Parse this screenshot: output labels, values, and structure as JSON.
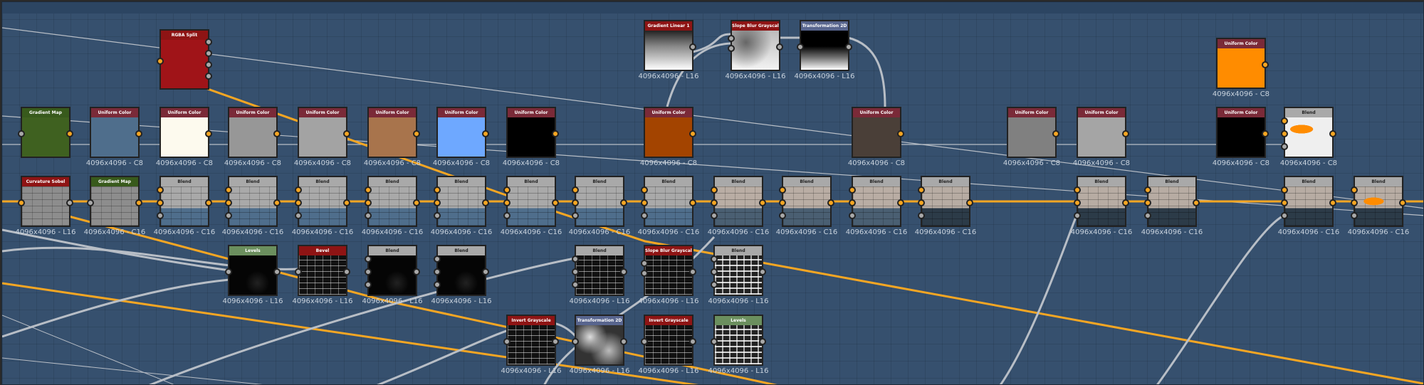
{
  "colors": {
    "uniform_header": "#7a2a38",
    "atomic_header": "#8e1414",
    "blend_header": "#a9a9a9",
    "gradient_map_header": "#385a1c",
    "levels_header": "#6b8f5e",
    "transform_header": "#58658e",
    "color_wire": "#f5a623",
    "gray_wire": "#b8bec6"
  },
  "nodes": [
    {
      "title": "RGBA Split",
      "kind": "atomic",
      "preview": "#a01418",
      "label": ""
    },
    {
      "title": "Gradient Linear 1",
      "kind": "atomic",
      "preview": "gradlin",
      "label": "4096x4096 - L16"
    },
    {
      "title": "Slope Blur Grayscale",
      "kind": "atomic",
      "preview": "slope",
      "label": "4096x4096 - L16"
    },
    {
      "title": "Transformation 2D",
      "kind": "transform",
      "preview": "gradblack",
      "label": "4096x4096 - L16"
    },
    {
      "title": "Uniform Color",
      "kind": "uniform",
      "preview": "#ff8c00",
      "label": "4096x4096 - C8"
    },
    {
      "title": "Gradient Map",
      "kind": "gradmap",
      "preview": "#3f6120",
      "label": ""
    },
    {
      "title": "Uniform Color",
      "kind": "uniform",
      "preview": "#4f6e8c",
      "label": "4096x4096 - C8"
    },
    {
      "title": "Uniform Color",
      "kind": "uniform",
      "preview": "#fdfaee",
      "label": "4096x4096 - C8"
    },
    {
      "title": "Uniform Color",
      "kind": "uniform",
      "preview": "#979797",
      "label": "4096x4096 - C8"
    },
    {
      "title": "Uniform Color",
      "kind": "uniform",
      "preview": "#a3a3a3",
      "label": "4096x4096 - C8"
    },
    {
      "title": "Uniform Color",
      "kind": "uniform",
      "preview": "#a8744c",
      "label": "4096x4096 - C8"
    },
    {
      "title": "Uniform Color",
      "kind": "uniform",
      "preview": "#6ea8ff",
      "label": "4096x4096 - C8"
    },
    {
      "title": "Uniform Color",
      "kind": "uniform",
      "preview": "#000000",
      "label": "4096x4096 - C8"
    },
    {
      "title": "Uniform Color",
      "kind": "uniform",
      "preview": "#a34400",
      "label": "4096x4096 - C8"
    },
    {
      "title": "Uniform Color",
      "kind": "uniform",
      "preview": "#4a3f38",
      "label": "4096x4096 - C8"
    },
    {
      "title": "Uniform Color",
      "kind": "uniform",
      "preview": "#808080",
      "label": "4096x4096 - C8"
    },
    {
      "title": "Uniform Color",
      "kind": "uniform",
      "preview": "#a5a5a5",
      "label": "4096x4096 - C8"
    },
    {
      "title": "Uniform Color",
      "kind": "uniform",
      "preview": "#000000",
      "label": "4096x4096 - C8"
    },
    {
      "title": "Blend",
      "kind": "blend",
      "preview": "graffiti",
      "label": "4096x4096 - C8"
    },
    {
      "title": "Curvature Sobel",
      "kind": "atomic",
      "preview": "brickgray",
      "label": "4096x4096 - L16"
    },
    {
      "title": "Gradient Map",
      "kind": "gradmap",
      "preview": "brickgray",
      "label": "4096x4096 - C16"
    },
    {
      "title": "Blend",
      "kind": "blend",
      "preview": "brickblue",
      "label": "4096x4096 - C16"
    },
    {
      "title": "Blend",
      "kind": "blend",
      "preview": "brickblue",
      "label": "4096x4096 - C16"
    },
    {
      "title": "Blend",
      "kind": "blend",
      "preview": "brickblue",
      "label": "4096x4096 - C16"
    },
    {
      "title": "Blend",
      "kind": "blend",
      "preview": "brickblue",
      "label": "4096x4096 - C16"
    },
    {
      "title": "Blend",
      "kind": "blend",
      "preview": "brickblue",
      "label": "4096x4096 - C16"
    },
    {
      "title": "Blend",
      "kind": "blend",
      "preview": "brickblue",
      "label": "4096x4096 - C16"
    },
    {
      "title": "Blend",
      "kind": "blend",
      "preview": "brickblue",
      "label": "4096x4096 - C16"
    },
    {
      "title": "Blend",
      "kind": "blend",
      "preview": "brickblue",
      "label": "4096x4096 - C16"
    },
    {
      "title": "Blend",
      "kind": "blend",
      "preview": "brickbeige",
      "label": "4096x4096 - C16"
    },
    {
      "title": "Blend",
      "kind": "blend",
      "preview": "brickbeige",
      "label": "4096x4096 - C16"
    },
    {
      "title": "Blend",
      "kind": "blend",
      "preview": "brickbeige",
      "label": "4096x4096 - C16"
    },
    {
      "title": "Blend",
      "kind": "blend",
      "preview": "brickdark",
      "label": "4096x4096 - C16"
    },
    {
      "title": "Blend",
      "kind": "blend",
      "preview": "brickdark",
      "label": "4096x4096 - C16"
    },
    {
      "title": "Blend",
      "kind": "blend",
      "preview": "brickdark",
      "label": "4096x4096 - C16"
    },
    {
      "title": "Blend",
      "kind": "blend",
      "preview": "brickdark",
      "label": "4096x4096 - C16"
    },
    {
      "title": "Blend",
      "kind": "blend",
      "preview": "graffitidark",
      "label": "4096x4096 - C16"
    },
    {
      "title": "Levels",
      "kind": "levels",
      "preview": "black",
      "label": "4096x4096 - L16"
    },
    {
      "title": "Bevel",
      "kind": "atomic",
      "preview": "mask",
      "label": "4096x4096 - L16"
    },
    {
      "title": "Blend",
      "kind": "blend",
      "preview": "black",
      "label": "4096x4096 - L16"
    },
    {
      "title": "Blend",
      "kind": "blend",
      "preview": "black",
      "label": "4096x4096 - L16"
    },
    {
      "title": "Blend",
      "kind": "blend",
      "preview": "mask",
      "label": "4096x4096 - L16"
    },
    {
      "title": "Slope Blur Grayscale",
      "kind": "atomic",
      "preview": "mask",
      "label": "4096x4096 - L16"
    },
    {
      "title": "Blend",
      "kind": "blend",
      "preview": "maskbright",
      "label": "4096x4096 - L16"
    },
    {
      "title": "Invert Grayscale",
      "kind": "atomic",
      "preview": "mask",
      "label": "4096x4096 - L16"
    },
    {
      "title": "Transformation 2D",
      "kind": "transform",
      "preview": "cloud",
      "label": "4096x4096 - L16"
    },
    {
      "title": "Invert Grayscale",
      "kind": "atomic",
      "preview": "mask",
      "label": "4096x4096 - L16"
    },
    {
      "title": "Levels",
      "kind": "levels",
      "preview": "maskbright",
      "label": "4096x4096 - L16"
    }
  ]
}
